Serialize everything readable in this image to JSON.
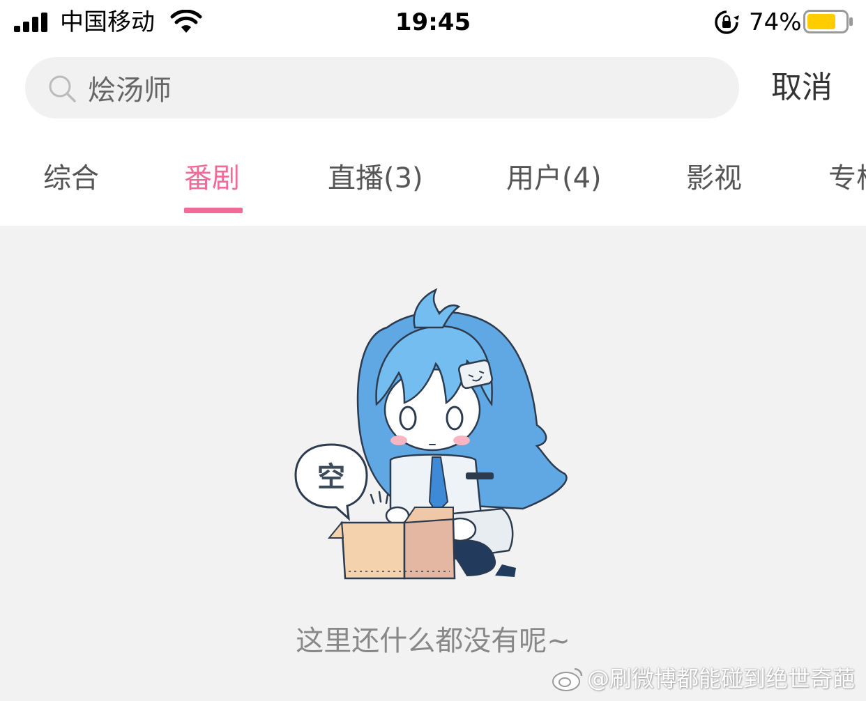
{
  "status_bar": {
    "carrier": "中国移动",
    "time": "19:45",
    "battery_percent": "74%",
    "battery_level": 0.74,
    "battery_color": "#ffcc00",
    "icons": [
      "signal-icon",
      "wifi-icon",
      "rotation-lock-icon",
      "battery-icon"
    ]
  },
  "search": {
    "query": "烩汤师",
    "cancel_label": "取消",
    "icon": "search-icon"
  },
  "tabs": [
    {
      "label": "综合",
      "active": false
    },
    {
      "label": "番剧",
      "active": true
    },
    {
      "label": "直播(3)",
      "active": false
    },
    {
      "label": "用户(4)",
      "active": false
    },
    {
      "label": "影视",
      "active": false
    },
    {
      "label": "专栏",
      "active": false
    }
  ],
  "colors": {
    "accent": "#f06c98",
    "content_background": "#f2f2f2",
    "search_background": "#f1f1f1"
  },
  "empty_state": {
    "bubble_text": "空",
    "message": "这里还什么都没有呢~",
    "illustration": "tv-girl-empty-box-illustration"
  },
  "watermark": {
    "text": "@刷微博都能碰到绝世奇葩",
    "icon": "weibo-logo-icon"
  }
}
